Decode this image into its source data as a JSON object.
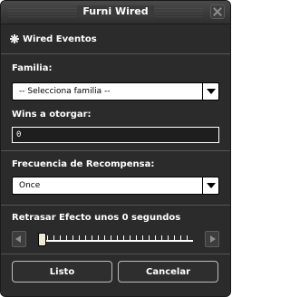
{
  "window": {
    "title": "Furni Wired"
  },
  "header": {
    "label": "Wired Eventos",
    "icon": "sparkle-icon"
  },
  "familia": {
    "label": "Familia:",
    "selected": "-- Selecciona familia --"
  },
  "wins": {
    "label": "Wins a otorgar:",
    "value": "0"
  },
  "frecuencia": {
    "label": "Frecuencia de Recompensa:",
    "selected": "Once"
  },
  "retraso": {
    "label": "Retrasar Efecto unos 0 segundos",
    "value": 0,
    "max": 20
  },
  "buttons": {
    "ok": "Listo",
    "cancel": "Cancelar"
  },
  "colors": {
    "background": "#2b2b2b",
    "titlebar": "#3a3a3a",
    "text": "#ffffff"
  }
}
